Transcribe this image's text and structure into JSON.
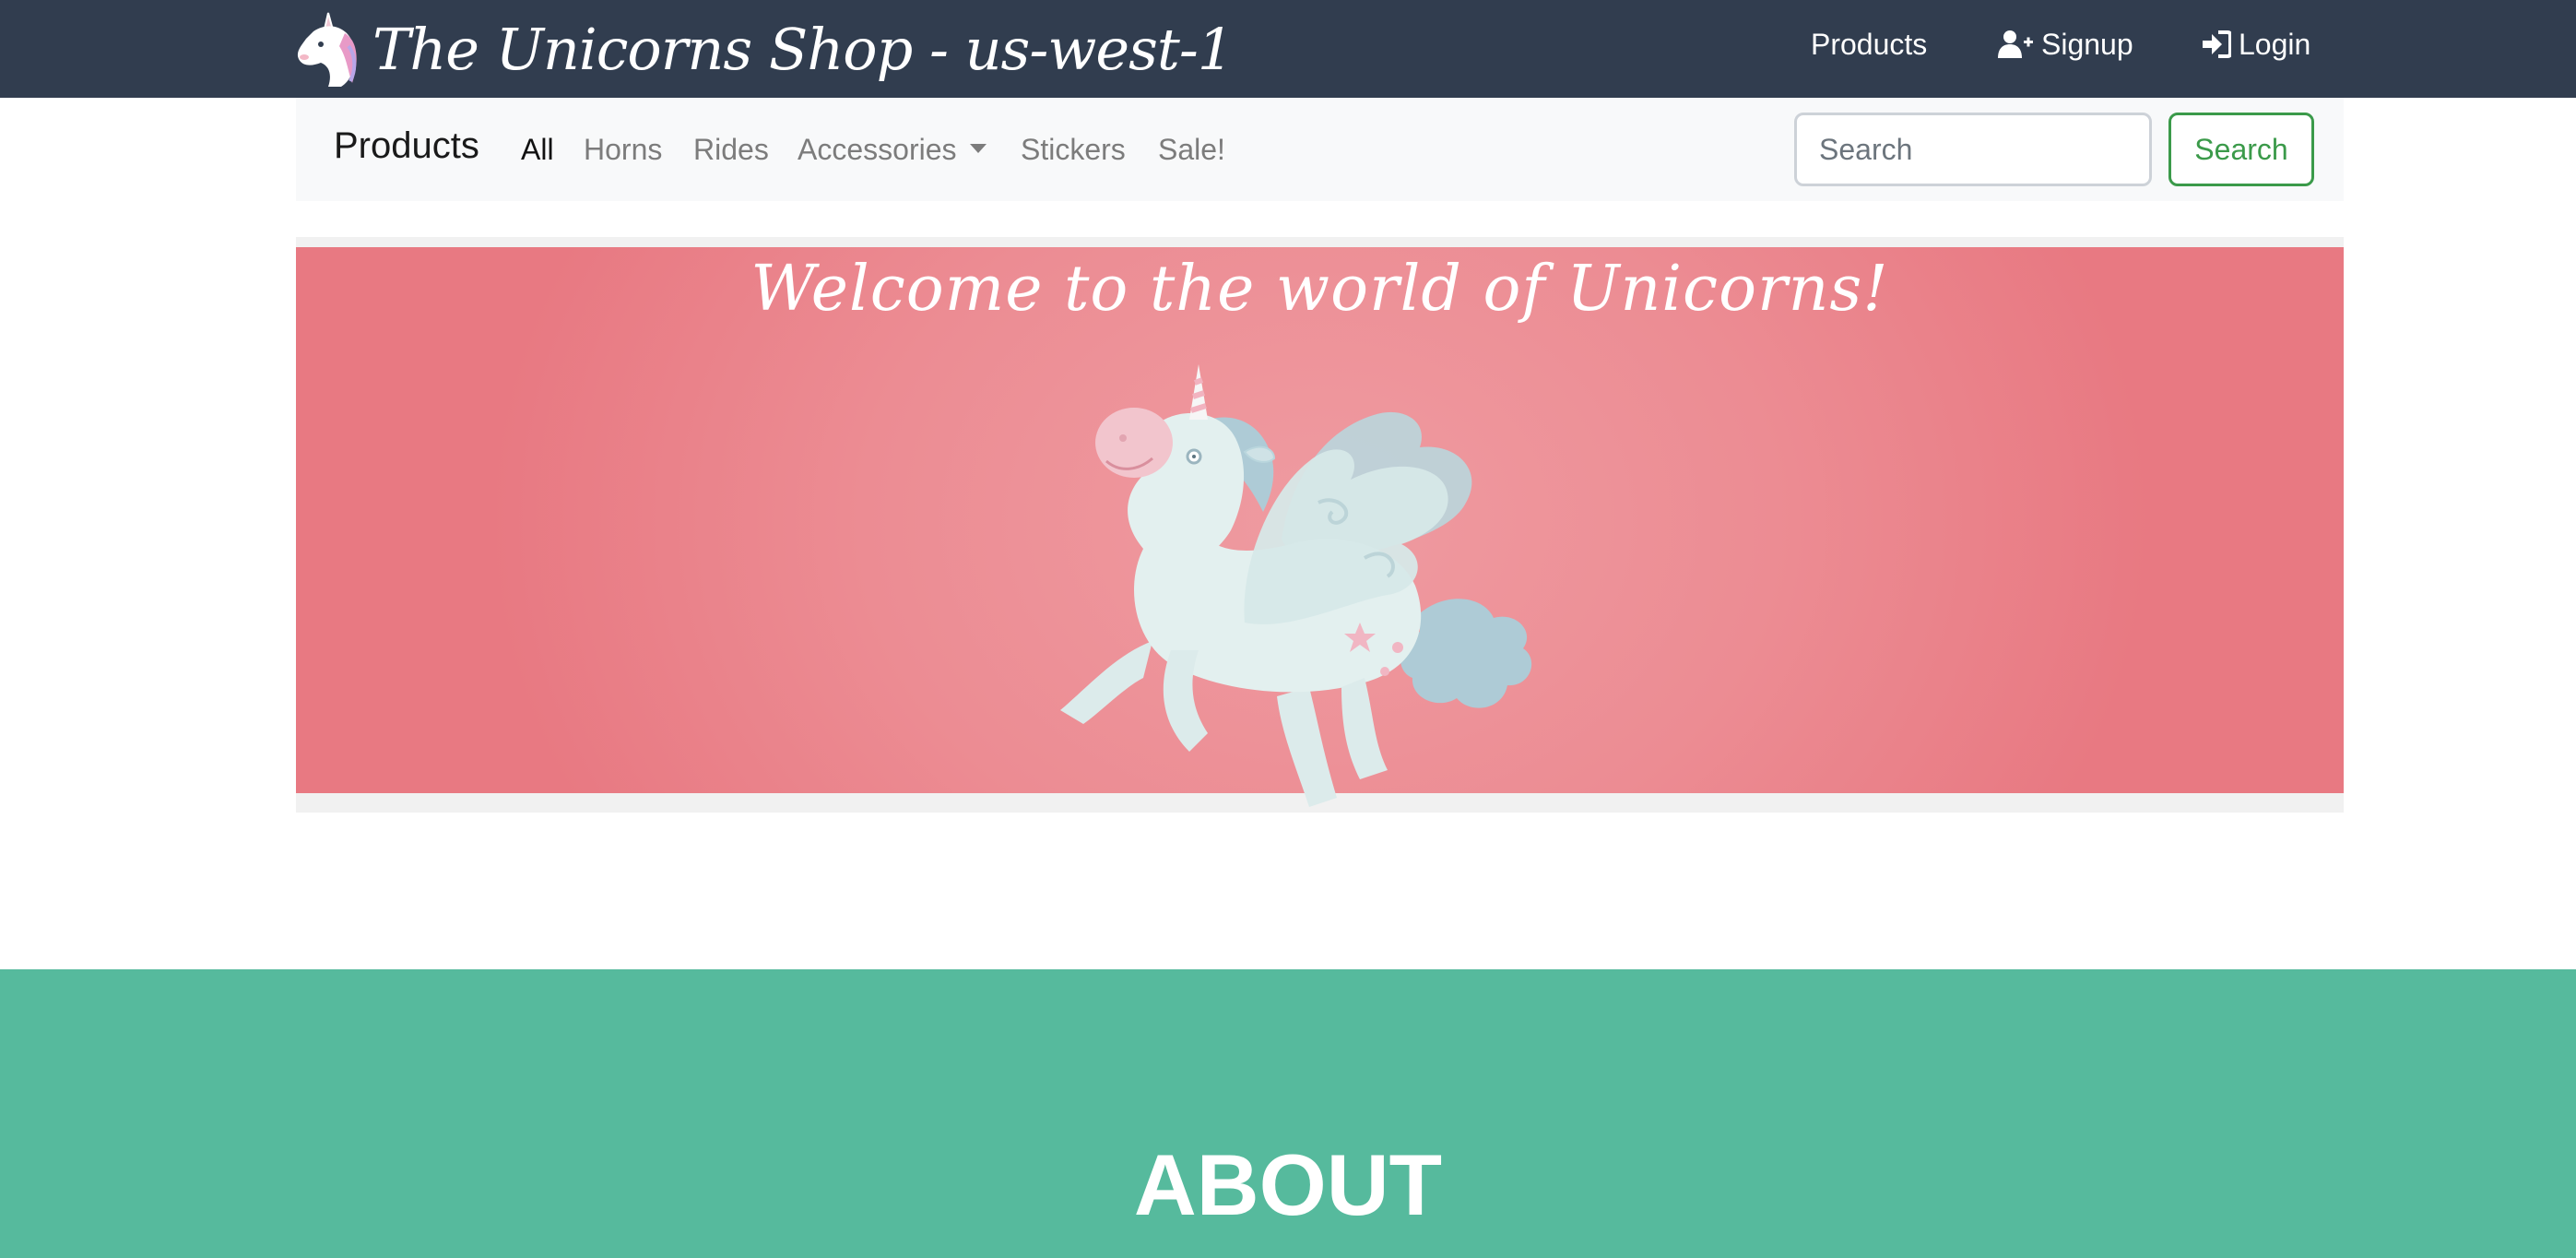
{
  "header": {
    "brand_title": "The Unicorns Shop - us-west-1",
    "nav": {
      "products_label": "Products",
      "signup_label": "Signup",
      "login_label": "Login"
    }
  },
  "subnav": {
    "brand": "Products",
    "links": [
      "All",
      "Horns",
      "Rides",
      "Accessories",
      "Stickers",
      "Sale!"
    ],
    "active": "All",
    "search_placeholder": "Search",
    "search_button": "Search"
  },
  "banner": {
    "title": "Welcome to the world of Unicorns!"
  },
  "about": {
    "title": "ABOUT"
  },
  "colors": {
    "topbar": "#313d4f",
    "banner_pink": "#ec8c93",
    "about_green": "#56ba9d",
    "search_green": "#3b9a4a"
  },
  "icons": {
    "brand_logo": "unicorn-head-icon",
    "signup": "user-plus-icon",
    "login": "sign-in-icon",
    "accessories_dropdown": "caret-down-icon"
  }
}
